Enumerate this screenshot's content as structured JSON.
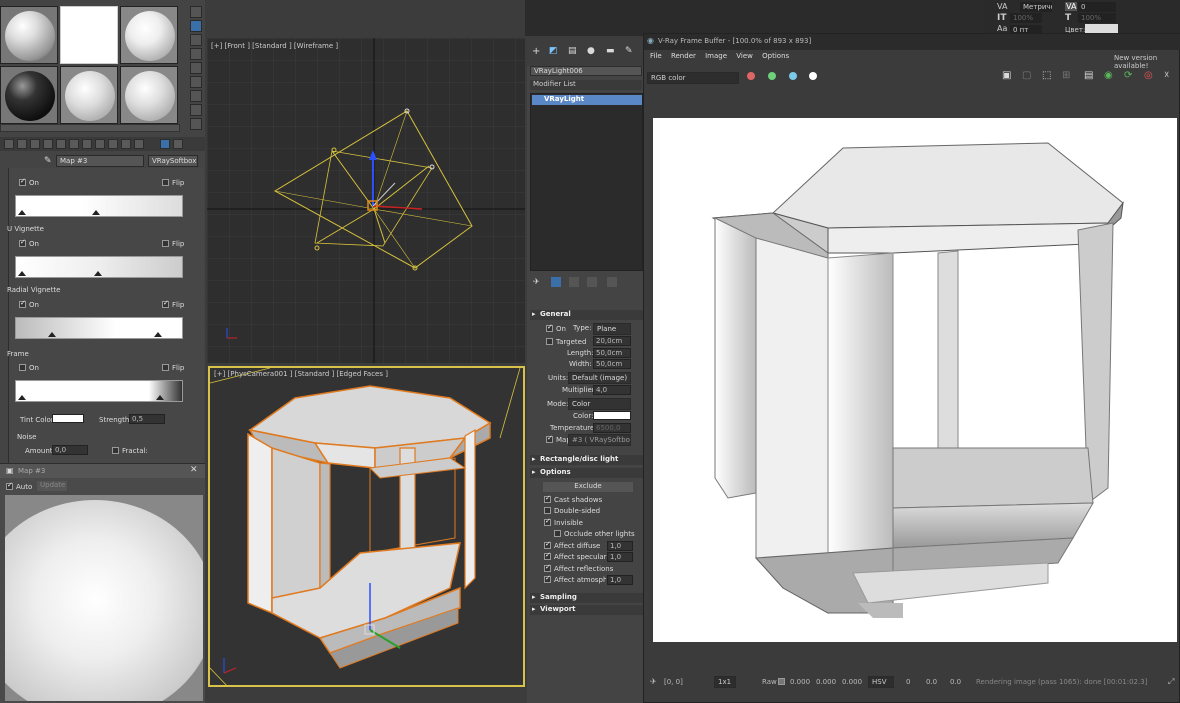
{
  "material_editor": {
    "map_dropdown": "Map #3",
    "map_type": "VRaySoftbox",
    "sections": [
      {
        "title": "",
        "on_label": "On",
        "on": true,
        "flip_label": "Flip",
        "flip": false
      },
      {
        "title": "U Vignette",
        "on_label": "On",
        "on": true,
        "flip_label": "Flip",
        "flip": false
      },
      {
        "title": "Radial Vignette",
        "on_label": "On",
        "on": true,
        "flip_label": "Flip",
        "flip": true
      },
      {
        "title": "Frame",
        "on_label": "On",
        "on": false,
        "flip_label": "Flip",
        "flip": false
      }
    ],
    "tint_label": "Tint Color:",
    "strength_label": "Strength:",
    "strength_value": "0,5",
    "noise_label": "Noise",
    "amount_label": "Amount:",
    "amount_value": "0,0",
    "fractal_label": "Fractal:"
  },
  "map_window": {
    "title": "Map #3",
    "auto_label": "Auto",
    "update_label": "Update"
  },
  "viewports": {
    "top_label": "[+] [Front ] [Standard ] [Wireframe ]",
    "cam_label": "[+] [PhysCamera001 ] [Standard ] [Edged Faces ]"
  },
  "command_panel": {
    "object_name": "VRayLight006",
    "modifier_list": "Modifier List",
    "stack_item": "VRayLight",
    "general_title": "General",
    "on_label": "On",
    "type_label": "Type:",
    "type_value": "Plane",
    "targeted_label": "Targeted",
    "targeted_value": "20,0cm",
    "length_label": "Length:",
    "length_value": "50,0cm",
    "width_label": "Width:",
    "width_value": "50,0cm",
    "units_label": "Units:",
    "units_value": "Default (image)",
    "multiplier_label": "Multiplier:",
    "multiplier_value": "4,0",
    "mode_label": "Mode:",
    "mode_value": "Color",
    "color_label": "Color:",
    "temperature_label": "Temperature:",
    "temperature_value": "6500,0",
    "map_label": "Map",
    "map_value": "#3 ( VRaySoftbox",
    "rect_title": "Rectangle/disc light",
    "options_title": "Options",
    "exclude_label": "Exclude",
    "options": [
      {
        "label": "Cast shadows",
        "on": true,
        "value": ""
      },
      {
        "label": "Double-sided",
        "on": false,
        "value": ""
      },
      {
        "label": "Invisible",
        "on": true,
        "value": ""
      },
      {
        "label": "Occlude other lights",
        "on": false,
        "value": ""
      },
      {
        "label": "Affect diffuse",
        "on": true,
        "value": "1,0"
      },
      {
        "label": "Affect specular",
        "on": true,
        "value": "1,0"
      },
      {
        "label": "Affect reflections",
        "on": true,
        "value": ""
      },
      {
        "label": "Affect atmospheric",
        "on": true,
        "value": "1,0"
      }
    ],
    "sampling_title": "Sampling",
    "viewport_title": "Viewport"
  },
  "frame_buffer": {
    "title": "V-Ray Frame Buffer - [100.0% of 893 x 893]",
    "menu": [
      "File",
      "Render",
      "Image",
      "View",
      "Options"
    ],
    "new_version": "New version available!",
    "channel": "RGB color",
    "dot_colors": [
      "#e06666",
      "#6fcf7a",
      "#7cc9e8"
    ],
    "status": {
      "coords": "[0, 0]",
      "ratio": "1x1",
      "raw_label": "Raw",
      "r": "0.000",
      "g": "0.000",
      "b": "0.000",
      "space": "HSV",
      "h": "0",
      "s": "0.0",
      "v": "0.0",
      "message": "Rendering image (pass 1065): done [00:01:02.3]"
    }
  },
  "text_panel": {
    "font_label": "Метрическ",
    "kern_value": "0",
    "size_pct": "100%",
    "size_pct2": "100%",
    "pt_value": "0 пт",
    "color_label": "Цвет:"
  }
}
